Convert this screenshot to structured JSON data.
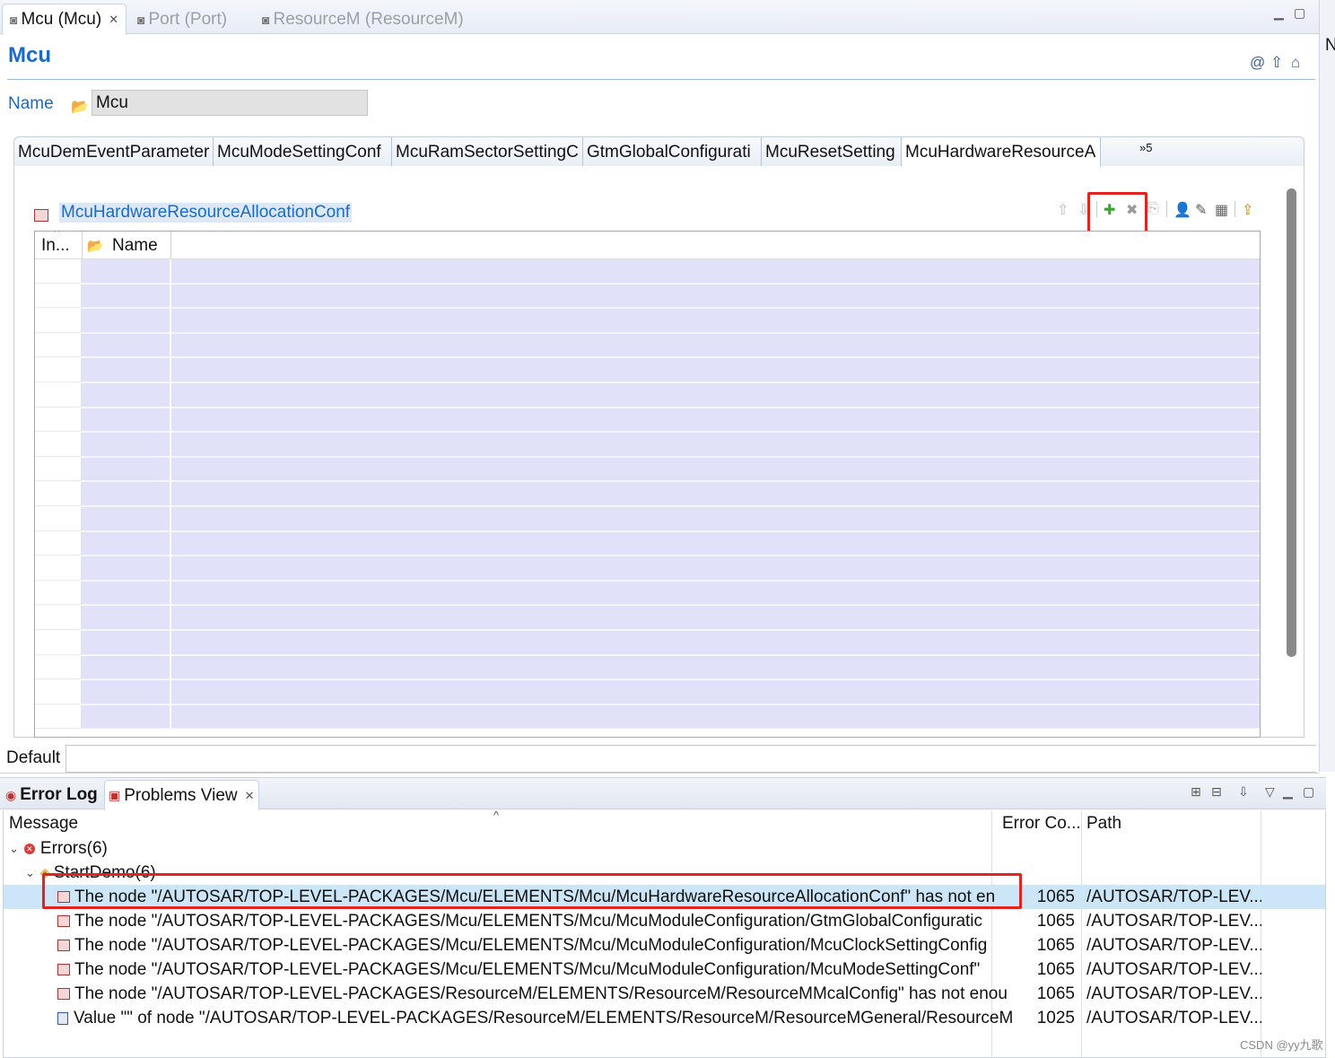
{
  "editor_tabs": [
    {
      "label": "Mcu (Mcu)",
      "active": true
    },
    {
      "label": "Port (Port)",
      "active": false
    },
    {
      "label": "ResourceM (ResourceM)",
      "active": false
    }
  ],
  "right_strip_letter": "N",
  "form": {
    "title": "Mcu",
    "name_label": "Name",
    "name_value": "Mcu"
  },
  "container_tabs": [
    "McuDemEventParameter",
    "McuModeSettingConf",
    "McuRamSectorSettingC",
    "GtmGlobalConfigurati",
    "McuResetSetting",
    "McuHardwareResourceA"
  ],
  "container_tabs_more": "»5",
  "section": {
    "title": "McuHardwareResourceAllocationConf",
    "columns": [
      "In...",
      "Name"
    ],
    "empty_rows": 19
  },
  "default_label": "Default",
  "views": {
    "tabs": [
      {
        "label": "Error Log",
        "active": false
      },
      {
        "label": "Problems View",
        "active": true
      }
    ]
  },
  "problems": {
    "columns": [
      "Message",
      "Error Co...",
      "Path"
    ],
    "group": "Errors(6)",
    "project": "StartDemo(6)",
    "rows": [
      {
        "message": "The node \"/AUTOSAR/TOP-LEVEL-PACKAGES/Mcu/ELEMENTS/Mcu/McuHardwareResourceAllocationConf\" has not en",
        "code": "1065",
        "path": "/AUTOSAR/TOP-LEV...",
        "selected": true,
        "icon": "node"
      },
      {
        "message": "The node \"/AUTOSAR/TOP-LEVEL-PACKAGES/Mcu/ELEMENTS/Mcu/McuModuleConfiguration/GtmGlobalConfiguratic",
        "code": "1065",
        "path": "/AUTOSAR/TOP-LEV...",
        "selected": false,
        "icon": "node"
      },
      {
        "message": "The node \"/AUTOSAR/TOP-LEVEL-PACKAGES/Mcu/ELEMENTS/Mcu/McuModuleConfiguration/McuClockSettingConfig",
        "code": "1065",
        "path": "/AUTOSAR/TOP-LEV...",
        "selected": false,
        "icon": "node"
      },
      {
        "message": "The node \"/AUTOSAR/TOP-LEVEL-PACKAGES/Mcu/ELEMENTS/Mcu/McuModuleConfiguration/McuModeSettingConf\"",
        "code": "1065",
        "path": "/AUTOSAR/TOP-LEV...",
        "selected": false,
        "icon": "node"
      },
      {
        "message": "The node \"/AUTOSAR/TOP-LEVEL-PACKAGES/ResourceM/ELEMENTS/ResourceM/ResourceMMcalConfig\" has not enou",
        "code": "1065",
        "path": "/AUTOSAR/TOP-LEV...",
        "selected": false,
        "icon": "node"
      },
      {
        "message": "Value \"\" of node \"/AUTOSAR/TOP-LEVEL-PACKAGES/ResourceM/ELEMENTS/ResourceM/ResourceMGeneral/ResourceM",
        "code": "1025",
        "path": "/AUTOSAR/TOP-LEV...",
        "selected": false,
        "icon": "value"
      }
    ]
  },
  "watermark": "CSDN @yy九歌",
  "colors": {
    "accent": "#1a6bc4",
    "highlight": "#e3241e",
    "grid_fill": "#e1e1fa",
    "selection": "#cde6f7"
  }
}
